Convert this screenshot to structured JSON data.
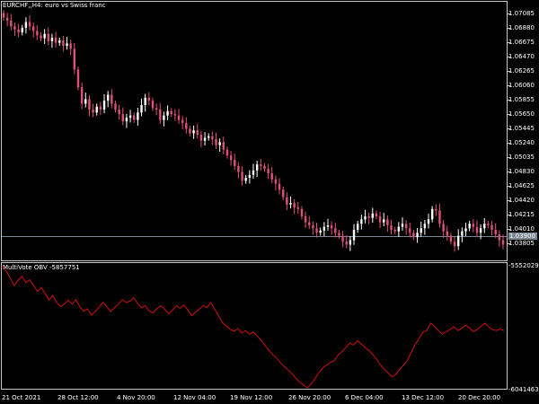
{
  "window": {
    "symbol_title": "EURCHF,,H4:  euro vs Swiss franc",
    "indicator_title": "MultiVote OBV -5857751"
  },
  "price_axis": {
    "ticks": [
      "1.07085",
      "1.06880",
      "1.06675",
      "1.06470",
      "1.06265",
      "1.06060",
      "1.05855",
      "1.05650",
      "1.05445",
      "1.05240",
      "1.05035",
      "1.04830",
      "1.04625",
      "1.04420",
      "1.04215",
      "1.04010",
      "1.03805"
    ],
    "current_price": "1.03900"
  },
  "indicator_axis": {
    "top": "-5552029",
    "bottom": "-6041463"
  },
  "time_axis": {
    "labels": [
      "21 Oct 2021",
      "28 Oct 12:00",
      "4 Nov 20:00",
      "12 Nov 04:00",
      "19 Nov 12:00",
      "26 Nov 20:00",
      "6 Dec 04:00",
      "13 Dec 12:00",
      "20 Dec 20:00"
    ]
  },
  "colors": {
    "bull_candle": "#ffffff",
    "bear_candle": "#e0507a",
    "obv_line": "#d01010",
    "frame": "#c8c8c8",
    "price_line": "#7a8691"
  },
  "chart_data": [
    {
      "type": "candlestick",
      "title": "EURCHF,,H4:  euro vs Swiss franc",
      "ylim": [
        1.0372,
        1.0718
      ],
      "series": [
        {
          "values": [
            1.0698,
            1.0694,
            1.0686,
            1.0682,
            1.0678,
            1.0684,
            1.0692,
            1.0686,
            1.068,
            1.0674,
            1.067,
            1.0676,
            1.0666,
            1.0671,
            1.0664,
            1.0667,
            1.066,
            1.0663,
            1.0656,
            1.0628,
            1.0604,
            1.0582,
            1.0588,
            1.0574,
            1.057,
            1.0578,
            1.0574,
            1.0586,
            1.0594,
            1.0582,
            1.0574,
            1.0568,
            1.0558,
            1.0563,
            1.0566,
            1.056,
            1.057,
            1.058,
            1.059,
            1.0586,
            1.0576,
            1.0574,
            1.056,
            1.0566,
            1.0572,
            1.0568,
            1.0566,
            1.056,
            1.0556,
            1.0548,
            1.0542,
            1.0546,
            1.054,
            1.0532,
            1.0536,
            1.0538,
            1.0534,
            1.0526,
            1.053,
            1.052,
            1.0512,
            1.0506,
            1.0498,
            1.049,
            1.0478,
            1.0482,
            1.0486,
            1.0492,
            1.05,
            1.0498,
            1.0494,
            1.0488,
            1.048,
            1.0474,
            1.0466,
            1.0456,
            1.0446,
            1.0448,
            1.0442,
            1.044,
            1.043,
            1.0422,
            1.0418,
            1.0414,
            1.0408,
            1.0411,
            1.0416,
            1.0418,
            1.0414,
            1.0408,
            1.0404,
            1.0396,
            1.0392,
            1.0398,
            1.0412,
            1.042,
            1.0426,
            1.043,
            1.0428,
            1.0434,
            1.043,
            1.0422,
            1.0426,
            1.0418,
            1.0412,
            1.041,
            1.0416,
            1.042,
            1.0414,
            1.0408,
            1.0402,
            1.0408,
            1.0414,
            1.042,
            1.0426,
            1.044,
            1.0438,
            1.042,
            1.041,
            1.0404,
            1.0396,
            1.039,
            1.0404,
            1.041,
            1.0414,
            1.042,
            1.0416,
            1.0408,
            1.0414,
            1.042,
            1.0418,
            1.0412,
            1.0406,
            1.0398,
            1.0392
          ]
        }
      ]
    },
    {
      "type": "line",
      "title": "MultiVote OBV -5857751",
      "ylim": [
        -6041463,
        -5552029
      ],
      "series": [
        {
          "name": "MultiVote OBV",
          "values": [
            -5552029,
            -5575000,
            -5603000,
            -5632000,
            -5610000,
            -5595000,
            -5620000,
            -5608000,
            -5630000,
            -5655000,
            -5640000,
            -5662000,
            -5690000,
            -5672000,
            -5700000,
            -5715000,
            -5705000,
            -5690000,
            -5706000,
            -5688000,
            -5716000,
            -5735000,
            -5724000,
            -5750000,
            -5736000,
            -5718000,
            -5699000,
            -5716000,
            -5736000,
            -5720000,
            -5706000,
            -5688000,
            -5700000,
            -5694000,
            -5680000,
            -5704000,
            -5720000,
            -5712000,
            -5734000,
            -5741000,
            -5724000,
            -5712000,
            -5726000,
            -5745000,
            -5730000,
            -5712000,
            -5722000,
            -5710000,
            -5728000,
            -5752000,
            -5738000,
            -5726000,
            -5712000,
            -5720000,
            -5700000,
            -5728000,
            -5752000,
            -5780000,
            -5794000,
            -5806000,
            -5815000,
            -5804000,
            -5822000,
            -5812000,
            -5826000,
            -5818000,
            -5834000,
            -5850000,
            -5872000,
            -5890000,
            -5908000,
            -5922000,
            -5940000,
            -5956000,
            -5970000,
            -5985000,
            -6002000,
            -6018000,
            -6030000,
            -6041463,
            -6026000,
            -6004000,
            -5980000,
            -5962000,
            -5950000,
            -5940000,
            -5932000,
            -5910000,
            -5896000,
            -5880000,
            -5862000,
            -5870000,
            -5852000,
            -5866000,
            -5880000,
            -5892000,
            -5908000,
            -5928000,
            -5950000,
            -5968000,
            -5982000,
            -5998000,
            -5988000,
            -5966000,
            -5950000,
            -5930000,
            -5898000,
            -5868000,
            -5842000,
            -5818000,
            -5812000,
            -5782000,
            -5795000,
            -5812000,
            -5826000,
            -5816000,
            -5808000,
            -5796000,
            -5812000,
            -5804000,
            -5790000,
            -5800000,
            -5816000,
            -5808000,
            -5796000,
            -5782000,
            -5796000,
            -5808000,
            -5812000,
            -5806000,
            -5812000
          ]
        }
      ]
    }
  ]
}
